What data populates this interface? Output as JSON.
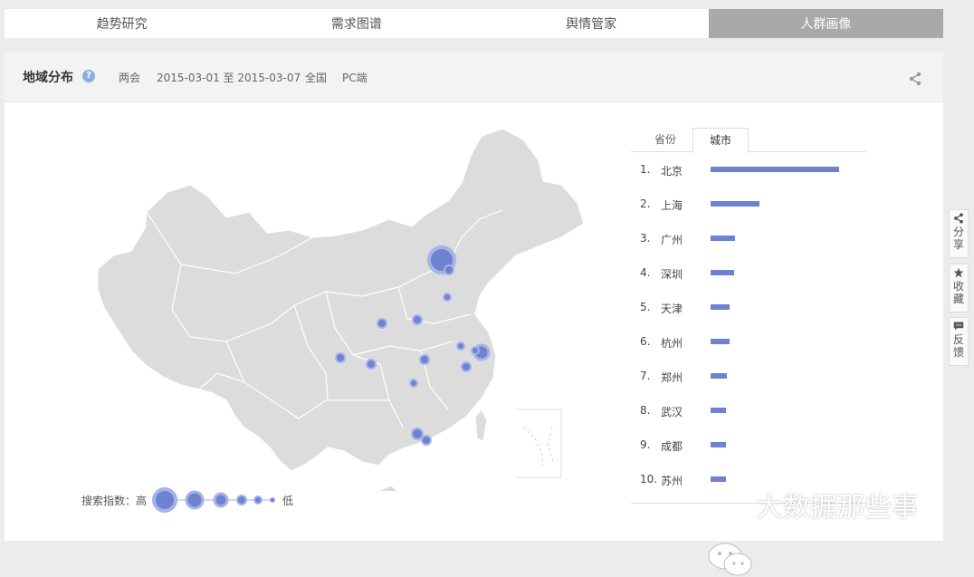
{
  "tabs": [
    {
      "label": "趋势研究",
      "active": false
    },
    {
      "label": "需求图谱",
      "active": false
    },
    {
      "label": "舆情管家",
      "active": false
    },
    {
      "label": "人群画像",
      "active": true
    }
  ],
  "header": {
    "title": "地域分布",
    "help": "?",
    "keyword": "两会",
    "date_range": "2015-03-01 至 2015-03-07",
    "region": "全国",
    "device": "PC端"
  },
  "ranking": {
    "tabs": [
      {
        "label": "省份",
        "active": false
      },
      {
        "label": "城市",
        "active": true
      }
    ],
    "items": [
      {
        "rank": "1.",
        "name": "北京",
        "value": 1.0
      },
      {
        "rank": "2.",
        "name": "上海",
        "value": 0.38
      },
      {
        "rank": "3.",
        "name": "广州",
        "value": 0.19
      },
      {
        "rank": "4.",
        "name": "深圳",
        "value": 0.18
      },
      {
        "rank": "5.",
        "name": "天津",
        "value": 0.15
      },
      {
        "rank": "6.",
        "name": "杭州",
        "value": 0.15
      },
      {
        "rank": "7.",
        "name": "郑州",
        "value": 0.13
      },
      {
        "rank": "8.",
        "name": "武汉",
        "value": 0.12
      },
      {
        "rank": "9.",
        "name": "成都",
        "value": 0.12
      },
      {
        "rank": "10.",
        "name": "苏州",
        "value": 0.12
      }
    ]
  },
  "legend": {
    "label": "搜索指数：高",
    "low": "低"
  },
  "side_toolbar": {
    "share": "分享",
    "favorite": "收藏",
    "feedback": "反馈"
  },
  "watermark": "大数据那些事",
  "colors": {
    "accent": "#6f82d2",
    "active_tab": "#a9a9a9",
    "map_fill": "#dcdcdc"
  }
}
